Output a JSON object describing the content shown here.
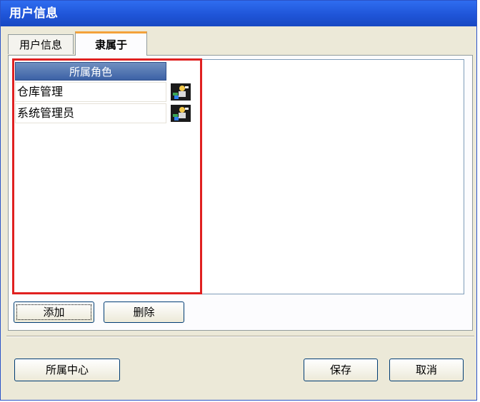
{
  "window": {
    "title": "用户信息"
  },
  "tabs": [
    {
      "label": "用户信息",
      "active": false
    },
    {
      "label": "隶属于",
      "active": true
    }
  ],
  "roles_list": {
    "column_header": "所属角色",
    "rows": [
      {
        "name": "仓库管理",
        "icon": "user-role-icon"
      },
      {
        "name": "系统管理员",
        "icon": "user-role-icon"
      }
    ]
  },
  "actions": {
    "add_label": "添加",
    "delete_label": "删除"
  },
  "footer": {
    "center_label": "所属中心",
    "save_label": "保存",
    "cancel_label": "取消"
  },
  "colors": {
    "title_bar": "#1f55d8",
    "highlight": "#e02020",
    "tab_accent": "#f3a23a"
  }
}
